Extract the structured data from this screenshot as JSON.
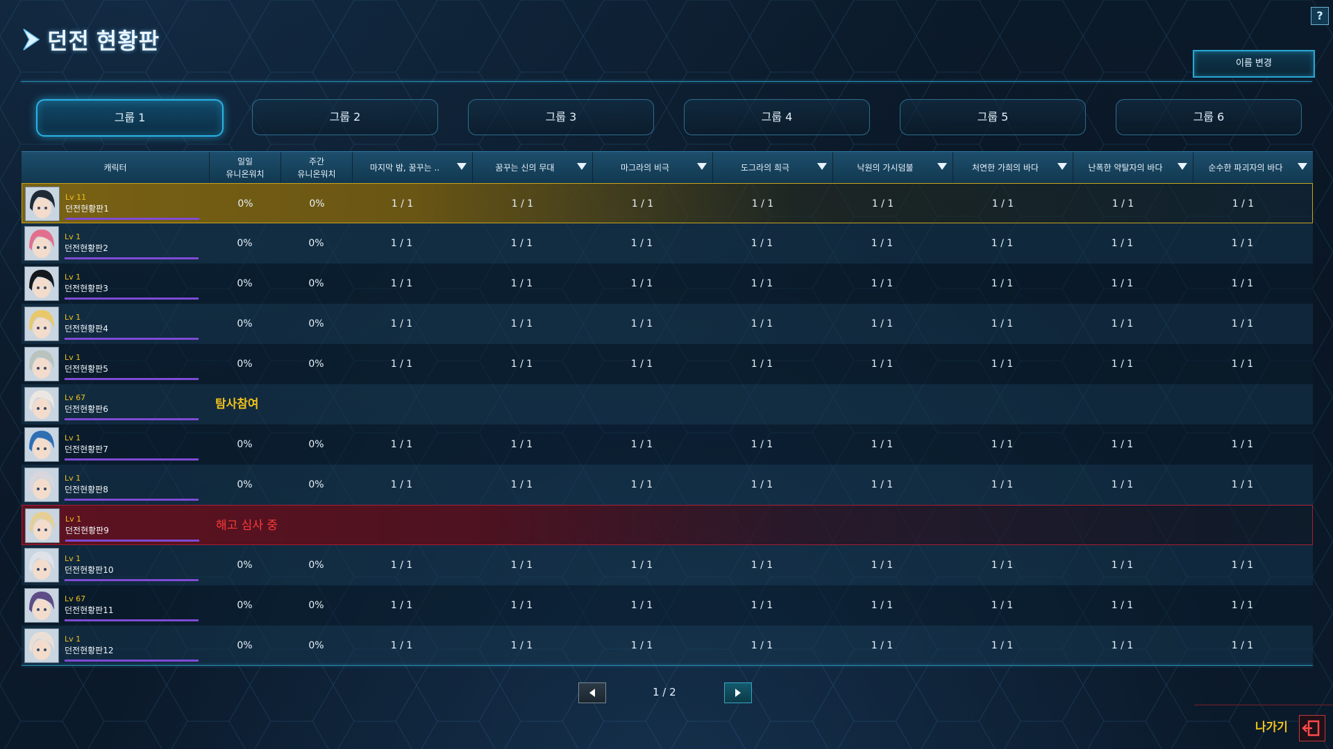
{
  "header": {
    "title": "던전 현황판",
    "help_label": "?",
    "rename_label": "이름 변경"
  },
  "tabs": [
    {
      "label": "그룹 1",
      "active": true
    },
    {
      "label": "그룹 2",
      "active": false
    },
    {
      "label": "그룹 3",
      "active": false
    },
    {
      "label": "그룹 4",
      "active": false
    },
    {
      "label": "그룹 5",
      "active": false
    },
    {
      "label": "그룹 6",
      "active": false
    }
  ],
  "columns": {
    "character": "캐릭터",
    "daily": [
      "일일",
      "유니온워치"
    ],
    "weekly": [
      "주간",
      "유니온워치"
    ],
    "dungeons": [
      "마지막 밤, 꿈꾸는 ..",
      "꿈꾸는 신의 무대",
      "마그라의 비극",
      "도그라의 희극",
      "낙원의 가시덤불",
      "처연한 가희의 바다",
      "난폭한 약탈자의 바다",
      "순수한 파괴자의 바다"
    ]
  },
  "rows": [
    {
      "level": "Lv 11",
      "name": "던전현황판1",
      "style": "gold",
      "daily": "0%",
      "weekly": "0%",
      "values": [
        "1 / 1",
        "1 / 1",
        "1 / 1",
        "1 / 1",
        "1 / 1",
        "1 / 1",
        "1 / 1",
        "1 / 1"
      ],
      "avatar": "dark-hair-boy-avatar"
    },
    {
      "level": "Lv 1",
      "name": "던전현황판2",
      "style": "odd",
      "daily": "0%",
      "weekly": "0%",
      "values": [
        "1 / 1",
        "1 / 1",
        "1 / 1",
        "1 / 1",
        "1 / 1",
        "1 / 1",
        "1 / 1",
        "1 / 1"
      ],
      "avatar": "pink-hair-girl-avatar"
    },
    {
      "level": "Lv 1",
      "name": "던전현황판3",
      "style": "even",
      "daily": "0%",
      "weekly": "0%",
      "values": [
        "1 / 1",
        "1 / 1",
        "1 / 1",
        "1 / 1",
        "1 / 1",
        "1 / 1",
        "1 / 1",
        "1 / 1"
      ],
      "avatar": "black-hair-girl-avatar"
    },
    {
      "level": "Lv 1",
      "name": "던전현황판4",
      "style": "odd",
      "daily": "0%",
      "weekly": "0%",
      "values": [
        "1 / 1",
        "1 / 1",
        "1 / 1",
        "1 / 1",
        "1 / 1",
        "1 / 1",
        "1 / 1",
        "1 / 1"
      ],
      "avatar": "blonde-boy-avatar"
    },
    {
      "level": "Lv 1",
      "name": "던전현황판5",
      "style": "even",
      "daily": "0%",
      "weekly": "0%",
      "values": [
        "1 / 1",
        "1 / 1",
        "1 / 1",
        "1 / 1",
        "1 / 1",
        "1 / 1",
        "1 / 1",
        "1 / 1"
      ],
      "avatar": "silver-hair-boy-avatar"
    },
    {
      "level": "Lv 67",
      "name": "던전현황판6",
      "style": "odd",
      "status": "탐사참여",
      "status_type": "join",
      "avatar": "white-hair-girl-avatar"
    },
    {
      "level": "Lv 1",
      "name": "던전현황판7",
      "style": "even",
      "daily": "0%",
      "weekly": "0%",
      "values": [
        "1 / 1",
        "1 / 1",
        "1 / 1",
        "1 / 1",
        "1 / 1",
        "1 / 1",
        "1 / 1",
        "1 / 1"
      ],
      "avatar": "blue-hair-boy-avatar"
    },
    {
      "level": "Lv 1",
      "name": "던전현황판8",
      "style": "odd",
      "daily": "0%",
      "weekly": "0%",
      "values": [
        "1 / 1",
        "1 / 1",
        "1 / 1",
        "1 / 1",
        "1 / 1",
        "1 / 1",
        "1 / 1",
        "1 / 1"
      ],
      "avatar": "silver-hair-girl-avatar"
    },
    {
      "level": "Lv 1",
      "name": "던전현황판9",
      "style": "red",
      "status": "해고 심사 중",
      "status_type": "fire",
      "avatar": "blonde-girl-avatar"
    },
    {
      "level": "Lv 1",
      "name": "던전현황판10",
      "style": "odd",
      "daily": "0%",
      "weekly": "0%",
      "values": [
        "1 / 1",
        "1 / 1",
        "1 / 1",
        "1 / 1",
        "1 / 1",
        "1 / 1",
        "1 / 1",
        "1 / 1"
      ],
      "avatar": "white-hair-boy-avatar"
    },
    {
      "level": "Lv 67",
      "name": "던전현황판11",
      "style": "even",
      "daily": "0%",
      "weekly": "0%",
      "values": [
        "1 / 1",
        "1 / 1",
        "1 / 1",
        "1 / 1",
        "1 / 1",
        "1 / 1",
        "1 / 1",
        "1 / 1"
      ],
      "avatar": "purple-hair-girl-avatar"
    },
    {
      "level": "Lv 1",
      "name": "던전현황판12",
      "style": "odd",
      "daily": "0%",
      "weekly": "0%",
      "values": [
        "1 / 1",
        "1 / 1",
        "1 / 1",
        "1 / 1",
        "1 / 1",
        "1 / 1",
        "1 / 1",
        "1 / 1"
      ],
      "avatar": "light-hair-girl-avatar"
    }
  ],
  "pager": {
    "page": "1 / 2",
    "prev_icon": "triangle-left-icon",
    "next_icon": "triangle-right-icon"
  },
  "footer": {
    "exit_label": "나가기",
    "exit_icon": "exit-door-icon"
  },
  "colors": {
    "accent": "#2ab4e6",
    "level": "#f0c21a",
    "exp_bar": "#7f4bd6",
    "join": "#f2c21a",
    "fire": "#ff3a3a",
    "gold_row": "#c9a41e",
    "red_row": "#a81d32"
  }
}
